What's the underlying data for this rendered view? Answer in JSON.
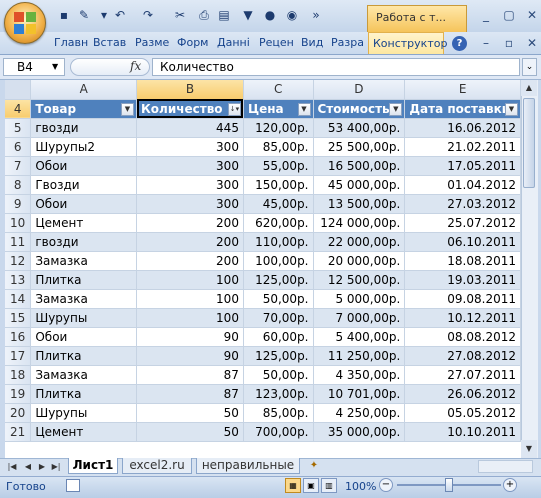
{
  "window": {
    "context_title": "Работа с т...",
    "buttons": {
      "minimize": "_",
      "restore": "▢",
      "close": "✕"
    }
  },
  "qat": {
    "icons": [
      "save-icon",
      "format-icon",
      "undo-icon",
      "redo-icon",
      "tool-icon",
      "print-icon",
      "doc-icon",
      "filter-icon",
      "new-icon",
      "more-icon"
    ]
  },
  "ribbon": {
    "tabs": [
      "Главн",
      "Вставі",
      "Разме",
      "Форм",
      "Данні",
      "Рецен",
      "Вид",
      "Разра"
    ],
    "context_tab": "Конструктор",
    "help": "?"
  },
  "formula_bar": {
    "name_box": "B4",
    "fx": "fx",
    "value": "Количество"
  },
  "columns": [
    "A",
    "B",
    "C",
    "D",
    "E"
  ],
  "selected_column": "B",
  "table": {
    "header_row": "4",
    "headers": [
      "Товар",
      "Количество",
      "Цена",
      "Стоимость",
      "Дата поставки"
    ],
    "rows": [
      {
        "r": "5",
        "cells": [
          "гвозди",
          "445",
          "120,00р.",
          "53 400,00р.",
          "16.06.2012"
        ]
      },
      {
        "r": "6",
        "cells": [
          "Шурупы2",
          "300",
          "85,00р.",
          "25 500,00р.",
          "21.02.2011"
        ]
      },
      {
        "r": "7",
        "cells": [
          "Обои",
          "300",
          "55,00р.",
          "16 500,00р.",
          "17.05.2011"
        ]
      },
      {
        "r": "8",
        "cells": [
          "Гвозди",
          "300",
          "150,00р.",
          "45 000,00р.",
          "01.04.2012"
        ]
      },
      {
        "r": "9",
        "cells": [
          "Обои",
          "300",
          "45,00р.",
          "13 500,00р.",
          "27.03.2012"
        ]
      },
      {
        "r": "10",
        "cells": [
          "Цемент",
          "200",
          "620,00р.",
          "124 000,00р.",
          "25.07.2012"
        ]
      },
      {
        "r": "11",
        "cells": [
          "гвозди",
          "200",
          "110,00р.",
          "22 000,00р.",
          "06.10.2011"
        ]
      },
      {
        "r": "12",
        "cells": [
          "Замазка",
          "200",
          "100,00р.",
          "20 000,00р.",
          "18.08.2011"
        ]
      },
      {
        "r": "13",
        "cells": [
          "Плитка",
          "100",
          "125,00р.",
          "12 500,00р.",
          "19.03.2011"
        ]
      },
      {
        "r": "14",
        "cells": [
          "Замазка",
          "100",
          "50,00р.",
          "5 000,00р.",
          "09.08.2011"
        ]
      },
      {
        "r": "15",
        "cells": [
          "Шурупы",
          "100",
          "70,00р.",
          "7 000,00р.",
          "10.12.2011"
        ]
      },
      {
        "r": "16",
        "cells": [
          "Обои",
          "90",
          "60,00р.",
          "5 400,00р.",
          "08.08.2012"
        ]
      },
      {
        "r": "17",
        "cells": [
          "Плитка",
          "90",
          "125,00р.",
          "11 250,00р.",
          "27.08.2012"
        ]
      },
      {
        "r": "18",
        "cells": [
          "Замазка",
          "87",
          "50,00р.",
          "4 350,00р.",
          "27.07.2011"
        ]
      },
      {
        "r": "19",
        "cells": [
          "Плитка",
          "87",
          "123,00р.",
          "10 701,00р.",
          "26.06.2012"
        ]
      },
      {
        "r": "20",
        "cells": [
          "Шурупы",
          "50",
          "85,00р.",
          "4 250,00р.",
          "05.05.2012"
        ]
      },
      {
        "r": "21",
        "cells": [
          "Цемент",
          "50",
          "700,00р.",
          "35 000,00р.",
          "10.10.2011"
        ]
      }
    ]
  },
  "sheets": {
    "tabs": [
      "Лист1",
      "excel2.ru",
      "неправильные"
    ],
    "active": "Лист1"
  },
  "status": {
    "text": "Готово",
    "zoom": "100%"
  },
  "colors": {
    "header_fill": "#4f81bd",
    "band_fill": "#dbe5f1",
    "selected_header": "#f8cc6e"
  }
}
